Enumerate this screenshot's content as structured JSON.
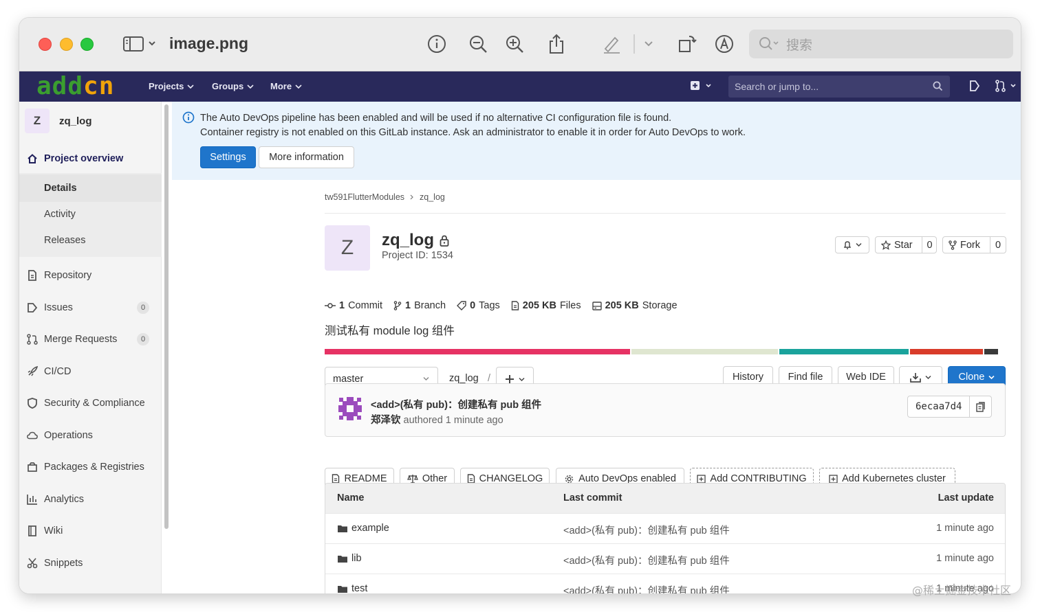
{
  "window": {
    "title": "image.png",
    "search_placeholder": "搜索"
  },
  "navbar": {
    "logo_a": "add",
    "logo_b": "cn",
    "menu": [
      "Projects",
      "Groups",
      "More"
    ],
    "search_placeholder": "Search or jump to..."
  },
  "sidebar": {
    "project_initial": "Z",
    "project_name": "zq_log",
    "overview": "Project overview",
    "sub": [
      "Details",
      "Activity",
      "Releases"
    ],
    "items": [
      {
        "label": "Repository",
        "icon": "doc-icon"
      },
      {
        "label": "Issues",
        "icon": "issues-icon",
        "count": "0"
      },
      {
        "label": "Merge Requests",
        "icon": "merge-request-icon",
        "count": "0"
      },
      {
        "label": "CI/CD",
        "icon": "rocket-icon"
      },
      {
        "label": "Security & Compliance",
        "icon": "shield-icon"
      },
      {
        "label": "Operations",
        "icon": "cloud-icon"
      },
      {
        "label": "Packages & Registries",
        "icon": "package-icon"
      },
      {
        "label": "Analytics",
        "icon": "chart-icon"
      },
      {
        "label": "Wiki",
        "icon": "book-icon"
      },
      {
        "label": "Snippets",
        "icon": "scissors-icon"
      }
    ]
  },
  "alert": {
    "line1": "The Auto DevOps pipeline has been enabled and will be used if no alternative CI configuration file is found.",
    "line2": "Container registry is not enabled on this GitLab instance. Ask an administrator to enable it in order for Auto DevOps to work.",
    "settings_btn": "Settings",
    "more_btn": "More information"
  },
  "breadcrumb": [
    "tw591FlutterModules",
    "zq_log"
  ],
  "project": {
    "initial": "Z",
    "name": "zq_log",
    "id_text": "Project ID: 1534",
    "star_label": "Star",
    "star_count": "0",
    "fork_label": "Fork",
    "fork_count": "0",
    "stats": [
      {
        "value": "1",
        "label": "Commit",
        "icon": "commit-icon"
      },
      {
        "value": "1",
        "label": "Branch",
        "icon": "branch-icon"
      },
      {
        "value": "0",
        "label": "Tags",
        "icon": "tag-icon"
      },
      {
        "value": "205 KB",
        "label": "Files",
        "icon": "file-icon"
      },
      {
        "value": "205 KB",
        "label": "Storage",
        "icon": "storage-icon"
      }
    ],
    "description": "测试私有 module log 组件",
    "languages": [
      {
        "color": "#e63264",
        "share": 0.455
      },
      {
        "color": "#dfe6d0",
        "share": 0.218
      },
      {
        "color": "#1aa39c",
        "share": 0.193
      },
      {
        "color": "#d93c2a",
        "share": 0.108
      },
      {
        "color": "#3a3a3a",
        "share": 0.021
      }
    ]
  },
  "repo_bar": {
    "branch": "master",
    "path": "zq_log",
    "sep": "/",
    "history": "History",
    "find_file": "Find file",
    "web_ide": "Web IDE",
    "clone": "Clone"
  },
  "commit": {
    "title": "<add>(私有 pub)：创建私有 pub 组件",
    "author": "郑泽钦",
    "authored": "authored 1 minute ago",
    "sha": "6ecaa7d4"
  },
  "shortcuts": [
    {
      "label": "README",
      "icon": "doc-icon",
      "dashed": false
    },
    {
      "label": "Other",
      "icon": "scale-icon",
      "dashed": false
    },
    {
      "label": "CHANGELOG",
      "icon": "doc-icon",
      "dashed": false
    },
    {
      "label": "Auto DevOps enabled",
      "icon": "gear-icon",
      "dashed": false
    },
    {
      "label": "Add CONTRIBUTING",
      "icon": "plus-square-icon",
      "dashed": true
    },
    {
      "label": "Add Kubernetes cluster",
      "icon": "plus-square-icon",
      "dashed": true
    }
  ],
  "files": {
    "headers": [
      "Name",
      "Last commit",
      "Last update"
    ],
    "rows": [
      {
        "name": "example",
        "commit": "<add>(私有 pub)：创建私有 pub 组件",
        "updated": "1 minute ago"
      },
      {
        "name": "lib",
        "commit": "<add>(私有 pub)：创建私有 pub 组件",
        "updated": "1 minute ago"
      },
      {
        "name": "test",
        "commit": "<add>(私有 pub)：创建私有 pub 组件",
        "updated": "1 minute ago"
      }
    ]
  },
  "watermark": "@稀土掘金技术社区"
}
